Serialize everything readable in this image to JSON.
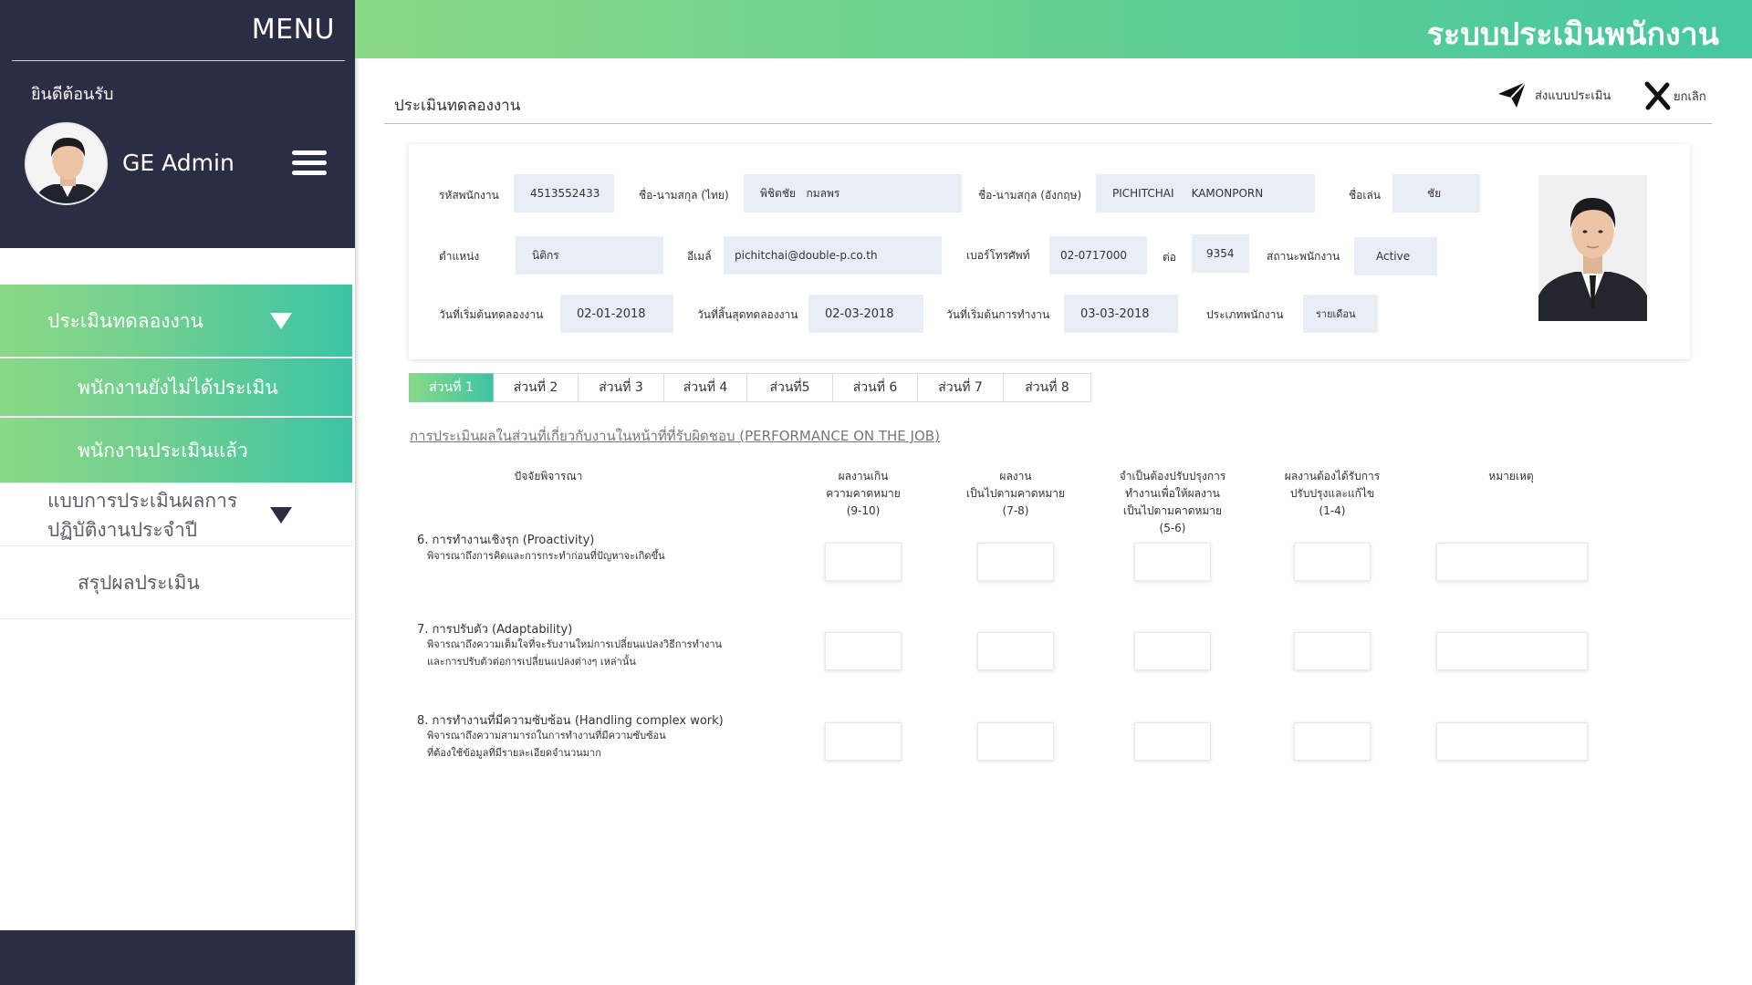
{
  "sidebar": {
    "menu_title": "MENU",
    "welcome": "ยินดีต้อนรับ",
    "user_name": "GE Admin",
    "nav": [
      {
        "label": "ประเมินทดลองงาน"
      },
      {
        "label": "พนักงานยังไม่ได้ประเมิน"
      },
      {
        "label": "พนักงานประเมินแล้ว"
      },
      {
        "label_line1": "แบบการประเมินผลการ",
        "label_line2": "ปฏิบัติงานประจำปี"
      },
      {
        "label": "สรุปผลประเมิน"
      }
    ]
  },
  "header": {
    "title": "ระบบประเมินพนักงาน"
  },
  "page": {
    "title": "ประเมินทดลองงาน",
    "actions": {
      "submit": "ส่งแบบประเมิน",
      "cancel": "ยกเลิก"
    }
  },
  "employee": {
    "labels": {
      "emp_id": "รหัสพนักงาน",
      "name_th": "ชื่อ-นามสกุล (ไทย)",
      "name_en": "ชื่อ-นามสกุล (อังกฤษ)",
      "nickname": "ชื่อเล่น",
      "position": "ตำแหน่ง",
      "email": "อีเมล์",
      "phone": "เบอร์โทรศัพท์",
      "ext": "ต่อ",
      "status": "สถานะพนักงาน",
      "trial_start": "วันที่เริ่มต้นทดลองงาน",
      "trial_end": "วันที่สิ้นสุดทดลองงาน",
      "work_start": "วันที่เริ่มต้นการทำงาน",
      "emp_type": "ประเภทพนักงาน"
    },
    "values": {
      "emp_id": "4513552433",
      "name_th": "พิชิตชัย   กมลพร",
      "name_en": "PICHITCHAI     KAMONPORN",
      "nickname": "ชัย",
      "position": "นิติกร",
      "email": "pichitchai@double-p.co.th",
      "phone": "02-0717000",
      "ext": "9354",
      "status": "Active",
      "trial_start": "02-01-2018",
      "trial_end": "02-03-2018",
      "work_start": "03-03-2018",
      "emp_type": "รายเดือน"
    }
  },
  "tabs": [
    "ส่วนที่ 1",
    "ส่วนที่ 2",
    "ส่วนที่  3",
    "ส่วนที่ 4",
    "ส่วนที่5",
    "ส่วนที่ 6",
    "ส่วนที่ 7",
    "ส่วนที่ 8"
  ],
  "active_tab": 0,
  "section_heading": "การประเมินผลในส่วนที่เกี่ยวกับงานในหน้าที่ที่รับผิดชอบ (PERFORMANCE ON THE JOB)",
  "table": {
    "factor_header": "ปัจจัยพิจารณา",
    "columns": [
      {
        "lines": [
          "ผลงานเกิน",
          "ความคาดหมาย",
          "(9-10)"
        ]
      },
      {
        "lines": [
          "ผลงาน",
          "เป็นไปตามคาดหมาย",
          "(7-8)"
        ]
      },
      {
        "lines": [
          "จำเป็นต้องปรับปรุงการ",
          "ทำงานเพื่อให้ผลงาน",
          "เป็นไปตามคาดหมาย",
          "(5-6)"
        ]
      },
      {
        "lines": [
          "ผลงานต้องได้รับการ",
          "ปรับปรุงและแก้ไข",
          "(1-4)"
        ]
      },
      {
        "lines": [
          "หมายเหตุ"
        ]
      }
    ],
    "criteria": [
      {
        "title": "6. การทำงานเชิงรุก (Proactivity)",
        "desc": [
          "พิจารณาถึงการคิดและการกระทำก่อนที่ปัญหาจะเกิดขึ้น"
        ]
      },
      {
        "title": "7. การปรับตัว (Adaptability)",
        "desc": [
          "พิจารณาถึงความเต็มใจที่จะรับงานใหม่การเปลี่ยนแปลงวิธีการทำงาน",
          "และการปรับตัวต่อการเปลี่ยนแปลงต่างๆ เหล่านั้น"
        ]
      },
      {
        "title": "8. การทำงานที่มีความซับซ้อน (Handling complex work)",
        "desc": [
          "พิจารณาถึงความสามารถในการทำงานที่มีความซับซ้อน",
          "ที่ต้องใช้ข้อมูลที่มีรายละเอียดจำนวนมาก"
        ]
      }
    ]
  },
  "icons": {
    "submit": "paper-plane-icon",
    "cancel": "x-icon",
    "menu": "hamburger-icon",
    "caret": "caret-down-icon"
  },
  "colors": {
    "sidebar_dark": "#2b2d45",
    "accent_start": "#8ad986",
    "accent_end": "#3cc4a5",
    "field_bg": "#e9edf5"
  }
}
